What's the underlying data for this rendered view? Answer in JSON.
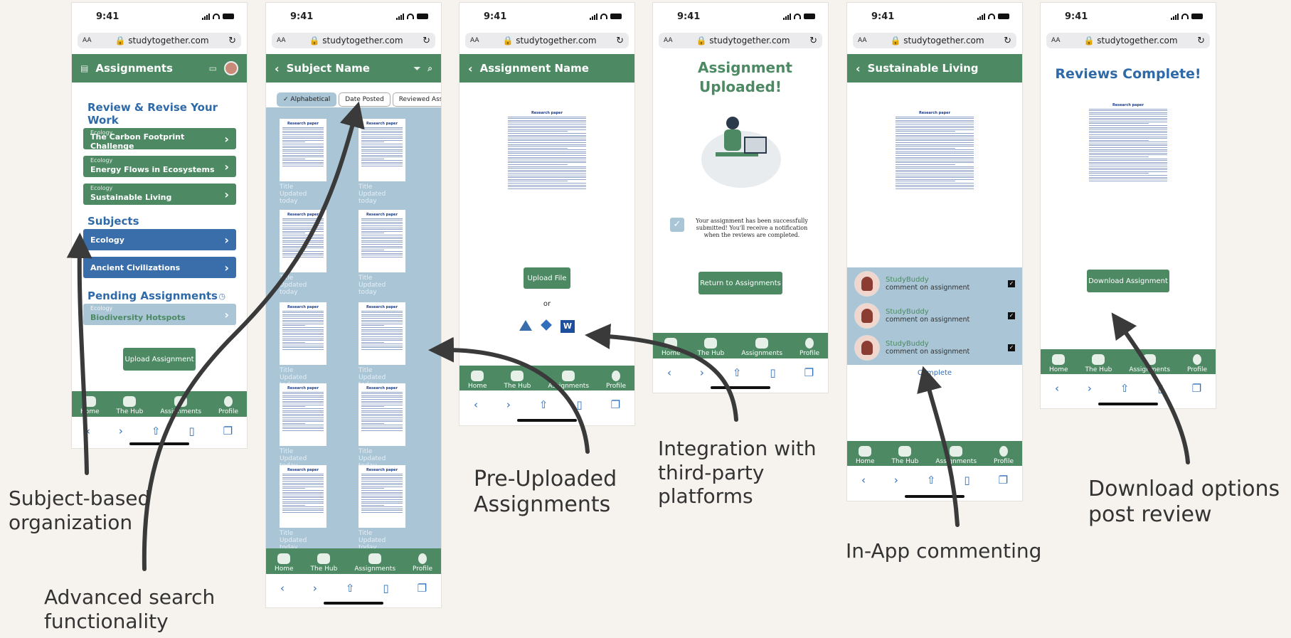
{
  "status": {
    "time": "9:41",
    "url": "studytogether.com",
    "aa": "AA"
  },
  "tabs": [
    "Home",
    "The Hub",
    "Assignments",
    "Profile"
  ],
  "screen1": {
    "title": "Assignments",
    "review_heading": "Review & Revise Your Work",
    "review_items": [
      {
        "subject": "Ecology",
        "title": "The Carbon Footprint Challenge"
      },
      {
        "subject": "Ecology",
        "title": "Energy Flows in Ecosystems"
      },
      {
        "subject": "Ecology",
        "title": "Sustainable Living"
      }
    ],
    "subjects_heading": "Subjects",
    "subjects": [
      "Ecology",
      "Ancient Civilizations"
    ],
    "pending_heading": "Pending Assignments",
    "pending_items": [
      {
        "subject": "Ecology",
        "title": "Biodiversity Hotspots"
      }
    ],
    "upload_button": "Upload Assignment"
  },
  "screen2": {
    "title": "Subject Name",
    "chips": [
      "Alphabetical",
      "Date Posted",
      "Reviewed Assignm"
    ],
    "doc_title": "Title",
    "doc_updated": "Updated today",
    "paper_heading": "Research paper"
  },
  "screen3": {
    "title": "Assignment Name",
    "paper_heading": "Research paper",
    "upload_button": "Upload File",
    "or": "or"
  },
  "screen4": {
    "heading": "Assignment Uploaded!",
    "message": "Your assignment has been successfully submitted! You'll receive a notification when the reviews are completed.",
    "return_button": "Return to Assignments"
  },
  "screen5": {
    "title": "Sustainable Living",
    "paper_heading": "Research paper",
    "comments": [
      {
        "name": "StudyBuddy",
        "text": "comment on assignment"
      },
      {
        "name": "StudyBuddy",
        "text": "comment on assignment"
      },
      {
        "name": "StudyBuddy",
        "text": "comment on assignment"
      }
    ],
    "complete": "Complete"
  },
  "screen6": {
    "heading": "Reviews Complete!",
    "paper_heading": "Research paper",
    "download_button": "Download Assignment"
  },
  "annotations": {
    "subject": "Subject-based organization",
    "search": "Advanced search functionality",
    "preupload": "Pre-Uploaded Assignments",
    "integration": "Integration with third-party platforms",
    "commenting": "In-App commenting",
    "download": "Download options post review"
  },
  "colors": {
    "brand_green": "#4d8a64",
    "brand_blue": "#3a6eab",
    "pale_blue": "#a9c5d6",
    "heading_blue": "#2f6aa8"
  }
}
